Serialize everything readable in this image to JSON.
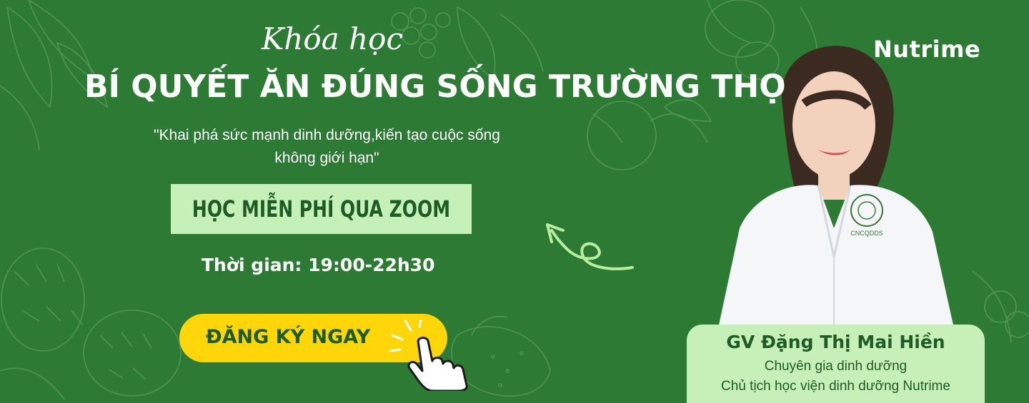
{
  "brand": {
    "logo_text": "Nutrime"
  },
  "headline": {
    "script": "Khóa học",
    "title": "BÍ QUYẾT ĂN ĐÚNG SỐNG TRƯỜNG THỌ",
    "quote_line1": "\"Khai phá sức mạnh dinh dưỡng,kiến tạo cuộc sống",
    "quote_line2": "không giới hạn\""
  },
  "badge": {
    "label": "HỌC MIỄN PHÍ QUA ZOOM"
  },
  "schedule": {
    "text": "Thời gian: 19:00-22h30"
  },
  "cta": {
    "label": "ĐĂNG KÝ NGAY"
  },
  "instructor": {
    "name": "GV Đặng Thị Mai Hiền",
    "role1": "Chuyên gia dinh dưỡng",
    "role2": "Chủ tịch học viện dinh dưỡng Nutrime",
    "coat_badge": "CNCQDDS"
  },
  "colors": {
    "background": "#2d7a35",
    "accent_green": "#c5f0b7",
    "cta_yellow": "#ffd60a",
    "dark_green_text": "#1e5b26"
  },
  "icons": [
    "hand-pointer-icon",
    "curved-arrow-icon",
    "fruit-sketch-icon"
  ]
}
